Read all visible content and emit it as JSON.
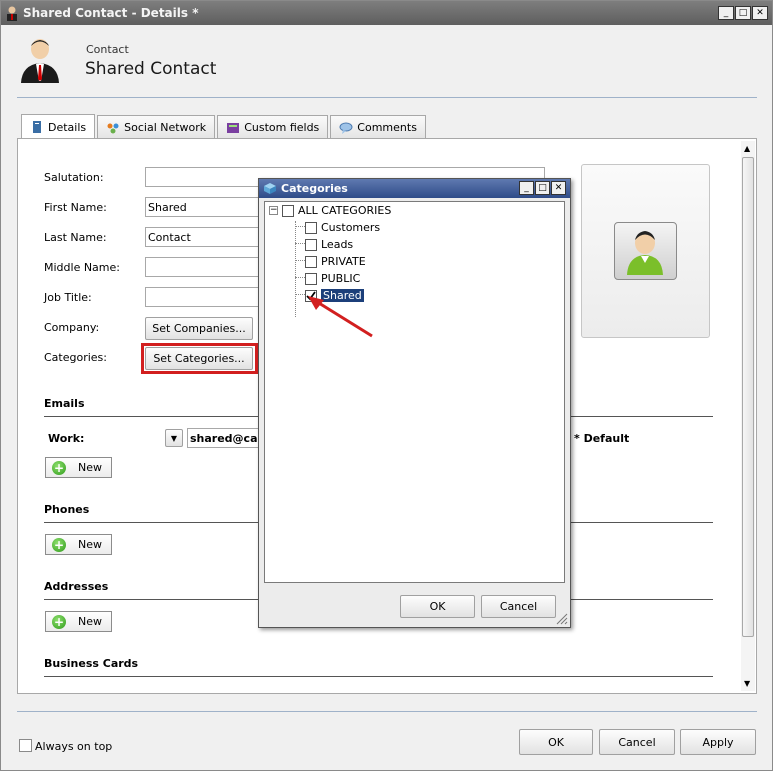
{
  "window": {
    "title": "Shared Contact  - Details *"
  },
  "header": {
    "subtitle": "Contact",
    "title": "Shared Contact"
  },
  "tabs": [
    {
      "label": "Details",
      "icon": "details-icon"
    },
    {
      "label": "Social Network",
      "icon": "social-network-icon"
    },
    {
      "label": "Custom fields",
      "icon": "custom-fields-icon"
    },
    {
      "label": "Comments",
      "icon": "comments-icon"
    }
  ],
  "form": {
    "salutation_label": "Salutation:",
    "first_name_label": "First Name:",
    "first_name_value": "Shared",
    "last_name_label": "Last Name:",
    "last_name_value": "Contact",
    "middle_name_label": "Middle Name:",
    "job_title_label": "Job Title:",
    "company_label": "Company:",
    "set_companies": "Set Companies...",
    "categories_label": "Categories:",
    "set_categories": "Set Categories..."
  },
  "emails": {
    "section": "Emails",
    "type": "Work:",
    "value": "shared@car",
    "default": "* Default",
    "new": "New"
  },
  "phones": {
    "section": "Phones",
    "new": "New"
  },
  "addresses": {
    "section": "Addresses",
    "new": "New"
  },
  "business_cards": {
    "section": "Business Cards"
  },
  "footer": {
    "always_on_top": "Always on top",
    "ok": "OK",
    "cancel": "Cancel",
    "apply": "Apply"
  },
  "dialog": {
    "title": "Categories",
    "root": "ALL CATEGORIES",
    "items": [
      {
        "label": "Customers",
        "checked": false
      },
      {
        "label": "Leads",
        "checked": false
      },
      {
        "label": "PRIVATE",
        "checked": false
      },
      {
        "label": "PUBLIC",
        "checked": false
      },
      {
        "label": "Shared",
        "checked": true
      }
    ],
    "ok": "OK",
    "cancel": "Cancel"
  },
  "colors": {
    "highlight": "#d21f1f",
    "selection": "#1c3f7a",
    "titlebar": "#2e4b88"
  }
}
